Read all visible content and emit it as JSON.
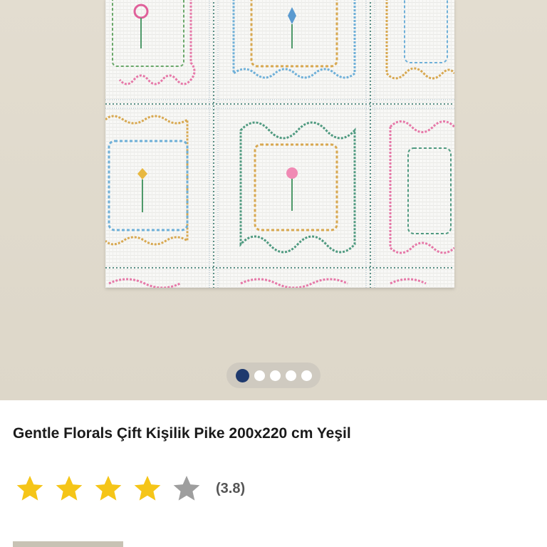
{
  "gallery": {
    "image_alt": "Gentle Florals pike bedspread",
    "dot_count": 5,
    "active_index": 0,
    "colors": {
      "background": "#e3ddd0",
      "active_dot": "#1f3a6e",
      "inactive_dot": "#ffffff"
    }
  },
  "product": {
    "title": "Gentle Florals Çift Kişilik Pike 200x220 cm Yeşil"
  },
  "rating": {
    "value": 3.8,
    "max": 5,
    "count_label": "(3.8)",
    "filled_color": "#f5c518",
    "empty_color": "#9e9e9e",
    "icon": "star-icon"
  }
}
